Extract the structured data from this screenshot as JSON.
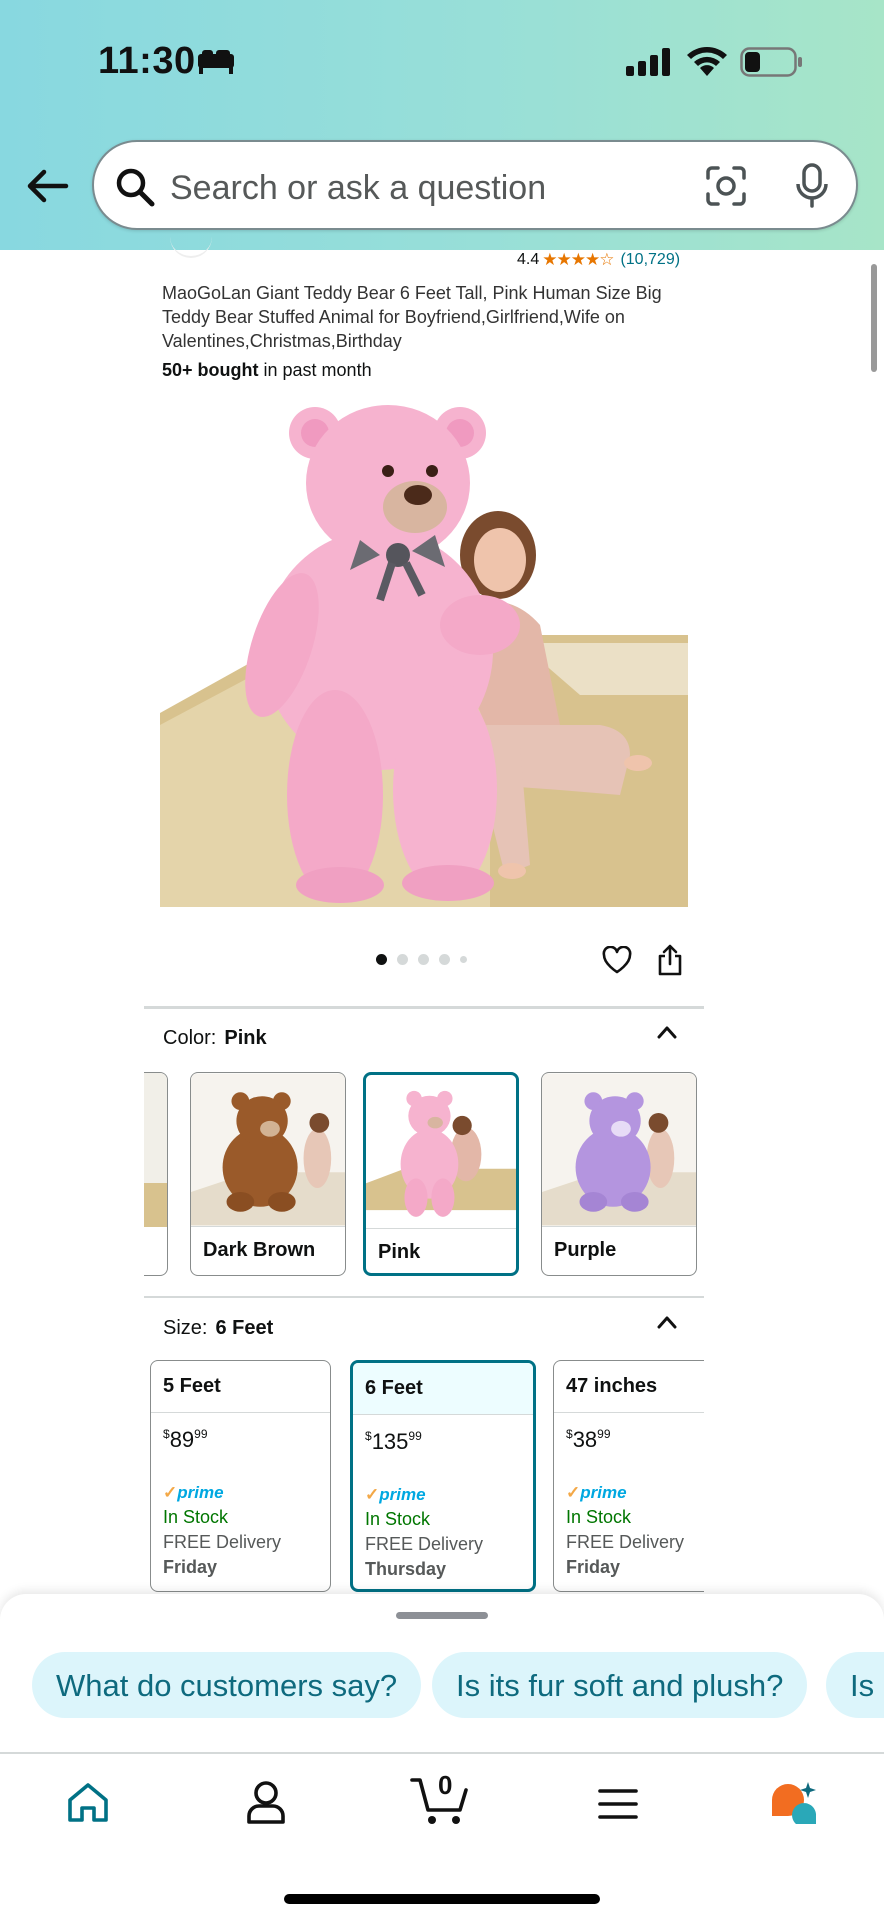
{
  "status_bar": {
    "time": "11:30"
  },
  "search": {
    "placeholder": "Search or ask a question"
  },
  "product": {
    "rating": "4.4",
    "stars_glyphs": "★★★★☆",
    "rating_count": "(10,729)",
    "title": "MaoGoLan Giant Teddy Bear 6 Feet Tall, Pink Human Size Big Teddy Bear Stuffed Animal for Boyfriend,Girlfriend,Wife on Valentines,Christmas,Birthday",
    "bought_bold": "50+ bought",
    "bought_rest": " in past month",
    "image_count": 5,
    "image_index": 1
  },
  "color": {
    "label": "Color:",
    "selected": "Pink",
    "options": [
      {
        "name": "Dark Brown",
        "bear_color": "#9a5a2a",
        "selected": false
      },
      {
        "name": "Pink",
        "bear_color": "#f6b3cf",
        "selected": true
      },
      {
        "name": "Purple",
        "bear_color": "#b495df",
        "selected": false
      }
    ]
  },
  "size": {
    "label": "Size:",
    "selected": "6 Feet",
    "options": [
      {
        "name": "5 Feet",
        "currency": "$",
        "price_whole": "89",
        "price_frac": "99",
        "prime": "prime",
        "stock": "In Stock",
        "delivery": "FREE Delivery",
        "day": "Friday",
        "selected": false
      },
      {
        "name": "6 Feet",
        "currency": "$",
        "price_whole": "135",
        "price_frac": "99",
        "prime": "prime",
        "stock": "In Stock",
        "delivery": "FREE Delivery",
        "day": "Thursday",
        "selected": true
      },
      {
        "name": "47 inches",
        "currency": "$",
        "price_whole": "38",
        "price_frac": "99",
        "prime": "prime",
        "stock": "In Stock",
        "delivery": "FREE Delivery",
        "day": "Friday",
        "selected": false
      }
    ]
  },
  "ask_chips": [
    "What do customers say?",
    "Is its fur soft and plush?",
    "Is i"
  ],
  "bottom_nav": {
    "cart_count": "0",
    "items": [
      "home-icon",
      "account-icon",
      "cart-icon",
      "menu-icon",
      "rufus-icon"
    ]
  },
  "colors": {
    "header_gradient_start": "#88d8e0",
    "header_gradient_end": "#a7e5c8",
    "accent_teal": "#007185",
    "in_stock_green": "#007600",
    "prime_blue": "#00a8e1",
    "star_orange": "#e77600"
  }
}
